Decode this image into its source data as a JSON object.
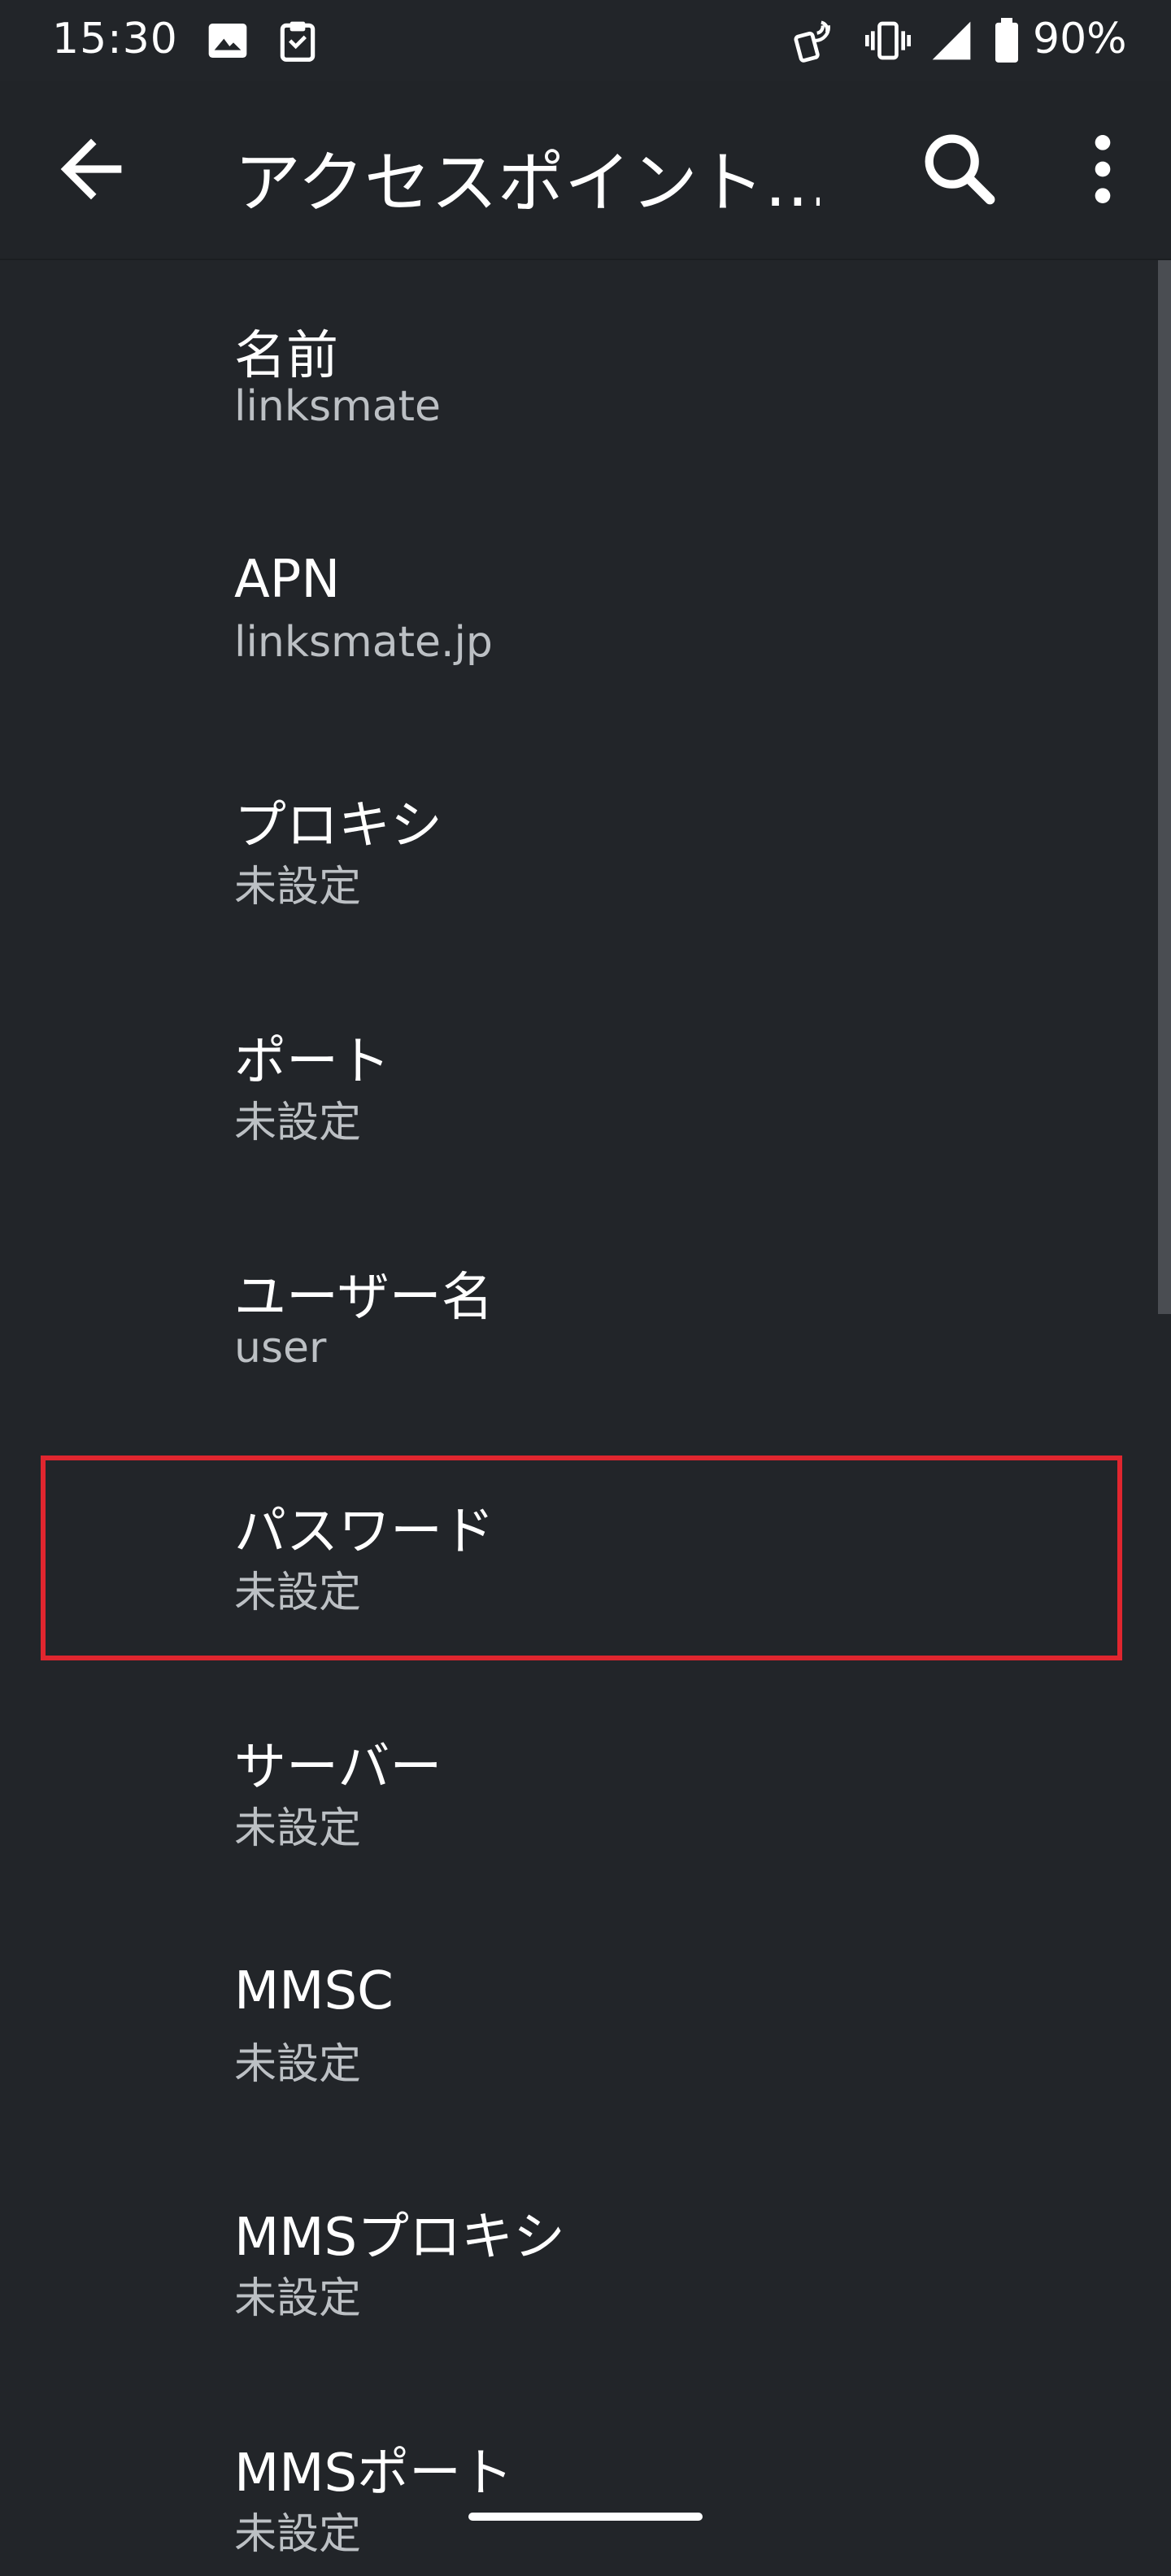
{
  "status_bar": {
    "time": "15:30",
    "battery_text": "90%",
    "icons_left": [
      "image-icon",
      "clipboard-icon"
    ],
    "icons_right": [
      "nfc-icon",
      "vibrate-icon",
      "signal-icon",
      "battery-icon"
    ]
  },
  "app_bar": {
    "title": "アクセスポイント…",
    "back_icon": "arrow-back-icon",
    "search_icon": "search-icon",
    "more_icon": "more-vert-icon"
  },
  "items": [
    {
      "title": "名前",
      "summary": "linksmate"
    },
    {
      "title": "APN",
      "summary": "linksmate.jp"
    },
    {
      "title": "プロキシ",
      "summary": "未設定"
    },
    {
      "title": "ポート",
      "summary": "未設定"
    },
    {
      "title": "ユーザー名",
      "summary": "user"
    },
    {
      "title": "パスワード",
      "summary": "未設定"
    },
    {
      "title": "サーバー",
      "summary": "未設定"
    },
    {
      "title": "MMSC",
      "summary": "未設定"
    },
    {
      "title": "MMSプロキシ",
      "summary": "未設定"
    },
    {
      "title": "MMSポート",
      "summary": "未設定"
    }
  ],
  "colors": {
    "background": "#222529",
    "highlight": "#e0262f",
    "summary_text": "#bcc0c4"
  }
}
